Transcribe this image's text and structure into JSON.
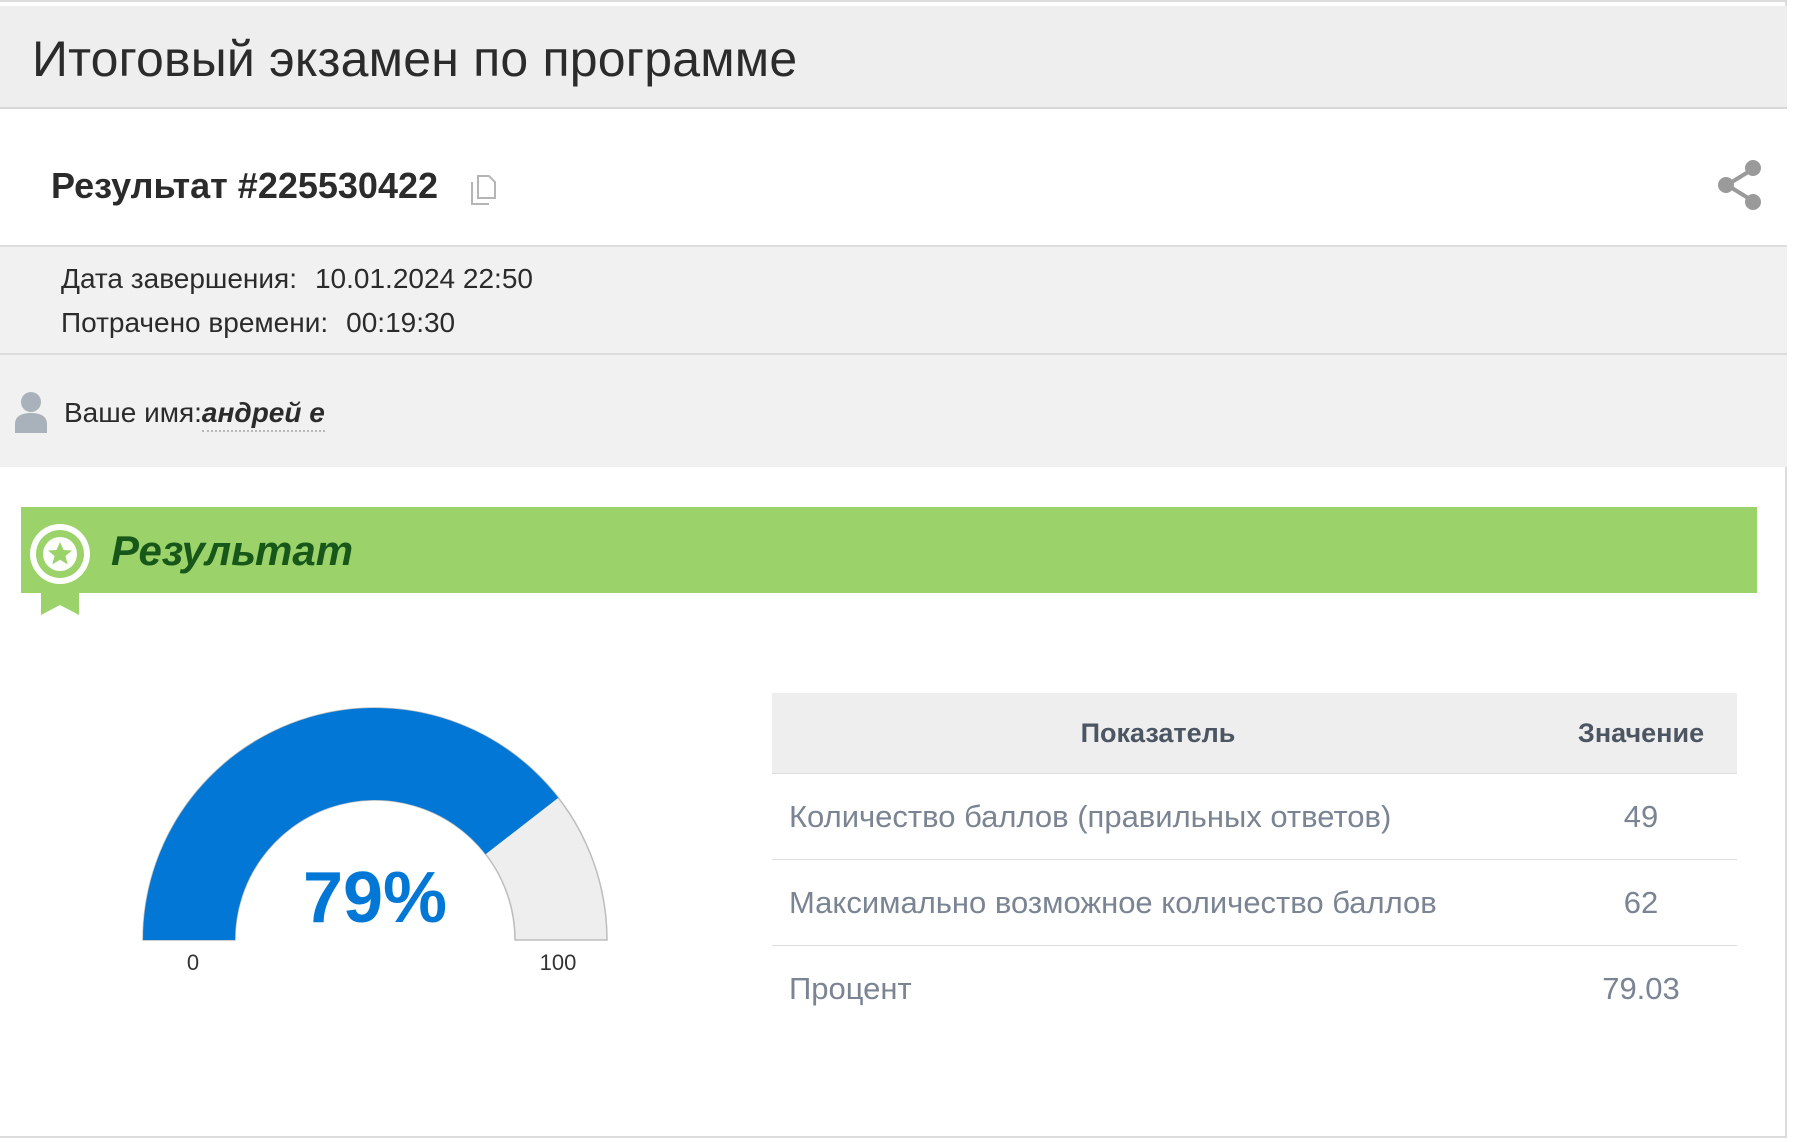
{
  "page": {
    "title": "Итоговый экзамен по программе"
  },
  "result": {
    "title": "Результат #225530422",
    "copy_icon": "copy-icon",
    "share_icon": "share-icon"
  },
  "meta": {
    "completion_label": "Дата завершения:",
    "completion_value": "10.01.2024 22:50",
    "time_label": "Потрачено времени:",
    "time_value": "00:19:30"
  },
  "user": {
    "icon": "user-icon",
    "name_label": "Ваше имя:",
    "name_value": "андрей е"
  },
  "banner": {
    "icon": "award-badge-icon",
    "label": "Результат",
    "color": "#9bd36a"
  },
  "gauge": {
    "value": 79,
    "display": "79%",
    "min_label": "0",
    "max_label": "100",
    "min": 0,
    "max": 100,
    "fill_color": "#0277d6",
    "track_color": "#eeeeee"
  },
  "table": {
    "headers": [
      "Показатель",
      "Значение"
    ],
    "rows": [
      {
        "label": "Количество баллов (правильных ответов)",
        "value": "49"
      },
      {
        "label": "Максимально возможное количество баллов",
        "value": "62"
      },
      {
        "label": "Процент",
        "value": "79.03"
      }
    ]
  }
}
